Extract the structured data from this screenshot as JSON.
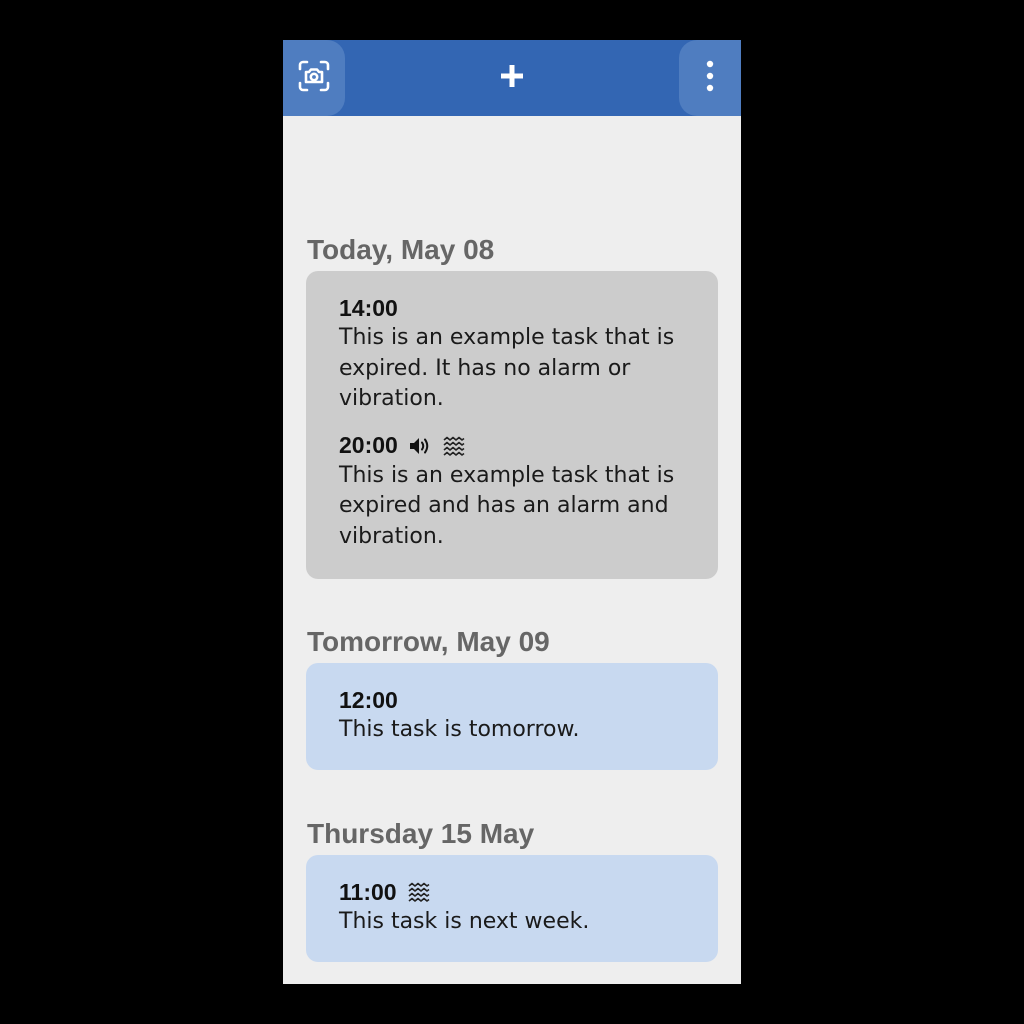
{
  "toolbar": {
    "left_icon": "camera-scan-icon",
    "center_icon": "plus-icon",
    "right_icon": "more-vertical-icon",
    "color": "#3366b3"
  },
  "sections": [
    {
      "title": "Today, May 08",
      "status": "expired",
      "tasks": [
        {
          "time": "14:00",
          "text": "This is an example task that is expired. It has no alarm or vibration.",
          "alarm": false,
          "vibration": false
        },
        {
          "time": "20:00",
          "text": "This is an example task that is expired and has an alarm and vibration.",
          "alarm": true,
          "vibration": true
        }
      ]
    },
    {
      "title": "Tomorrow, May 09",
      "status": "upcoming",
      "tasks": [
        {
          "time": "12:00",
          "text": "This task is tomorrow.",
          "alarm": false,
          "vibration": false
        }
      ]
    },
    {
      "title": "Thursday 15 May",
      "status": "upcoming",
      "tasks": [
        {
          "time": "11:00",
          "text": "This task is next week.",
          "alarm": false,
          "vibration": true
        }
      ]
    }
  ],
  "colors": {
    "expired_card": "#cccccc",
    "upcoming_card": "#c8d9f0",
    "section_title": "#666666"
  }
}
